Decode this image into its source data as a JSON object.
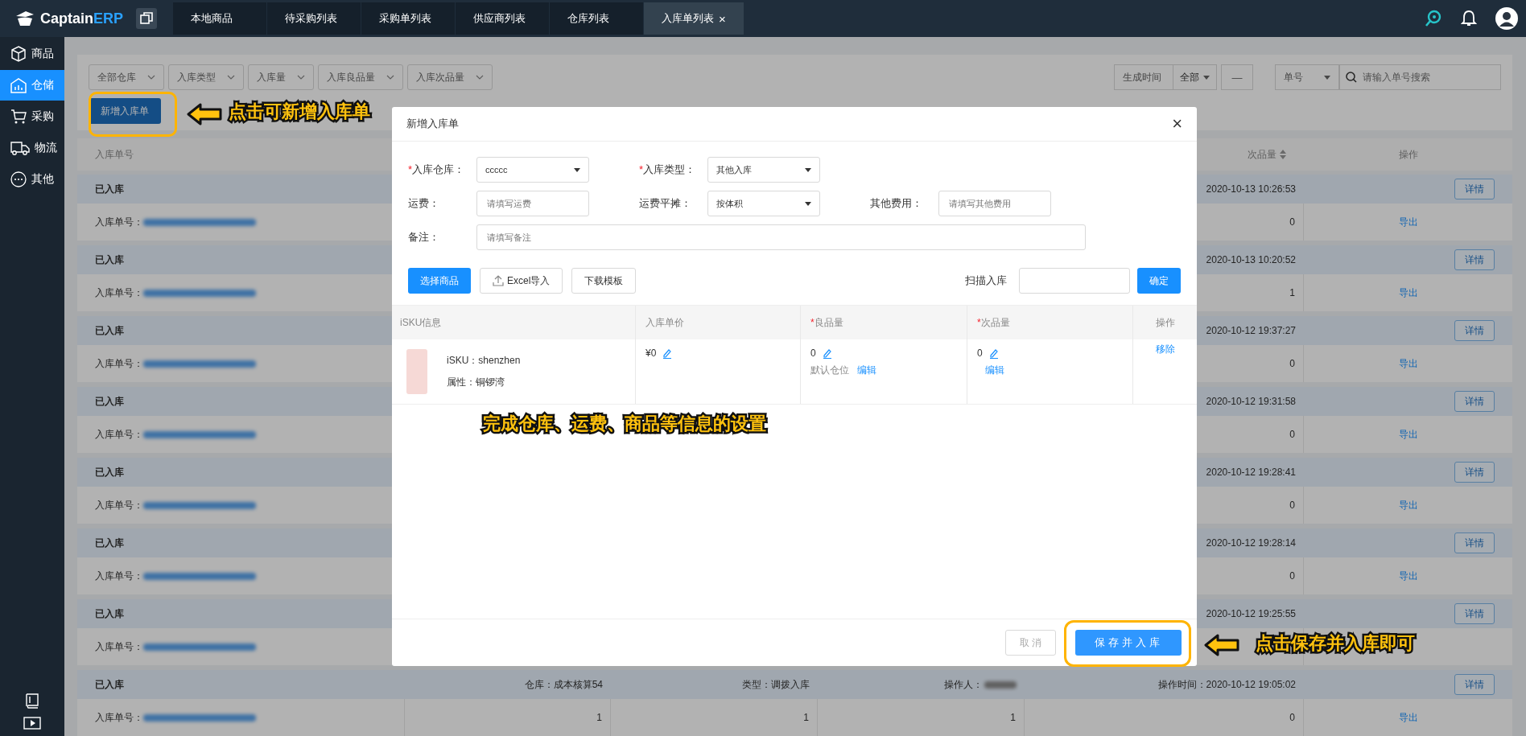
{
  "app": {
    "logo_main": "Captain",
    "logo_accent": "ERP"
  },
  "tabs": [
    {
      "label": "本地商品",
      "selected": false
    },
    {
      "label": "待采购列表",
      "selected": false
    },
    {
      "label": "采购单列表",
      "selected": false
    },
    {
      "label": "供应商列表",
      "selected": false
    },
    {
      "label": "仓库列表",
      "selected": false
    },
    {
      "label": "入库单列表",
      "selected": true,
      "close": "×"
    }
  ],
  "sidebar": {
    "items": [
      {
        "label": "商品",
        "kind": "goods",
        "selected": false
      },
      {
        "label": "仓储",
        "kind": "storage",
        "selected": true
      },
      {
        "label": "采购",
        "kind": "purchase",
        "selected": false
      },
      {
        "label": "物流",
        "kind": "logistics",
        "selected": false
      },
      {
        "label": "其他",
        "kind": "other",
        "selected": false
      }
    ]
  },
  "filters": {
    "selects": [
      "全部仓库",
      "入库类型",
      "入库量",
      "入库良品量",
      "入库次品量"
    ],
    "date_label": "生成时间",
    "date_range": "全部",
    "date_separator": "—",
    "search_by": "单号",
    "search": {
      "placeholder": "请输入单号搜索"
    }
  },
  "new_button": "新增入库单",
  "table": {
    "columns": {
      "order_no": "入库单号",
      "defect_qty": "次品量",
      "actions": "操作"
    },
    "orders": [
      {
        "status": "已入库",
        "time": "2020-10-13 10:26:53",
        "detail": "详情",
        "order_label": "入库单号：",
        "defect": "0",
        "action": "导出"
      },
      {
        "status": "已入库",
        "time": "2020-10-13 10:20:52",
        "detail": "详情",
        "order_label": "入库单号：",
        "defect": "1",
        "action": "导出"
      },
      {
        "status": "已入库",
        "time": "2020-10-12 19:37:27",
        "detail": "详情",
        "order_label": "入库单号：",
        "defect": "0",
        "action": "导出"
      },
      {
        "status": "已入库",
        "time": "2020-10-12 19:31:58",
        "detail": "详情",
        "order_label": "入库单号：",
        "defect": "0",
        "action": "导出"
      },
      {
        "status": "已入库",
        "time": "2020-10-12 19:28:41",
        "detail": "详情",
        "order_label": "入库单号：",
        "defect": "0",
        "action": "导出"
      },
      {
        "status": "已入库",
        "time": "2020-10-12 19:28:14",
        "detail": "详情",
        "order_label": "入库单号：",
        "defect": "0",
        "action": "导出"
      },
      {
        "status": "已入库",
        "time": "2020-10-12 19:25:55",
        "detail": "详情",
        "order_label": "入库单号："
      },
      {
        "status": "已入库",
        "warehouse": "仓库：成本核算54",
        "type": "类型：调拨入库",
        "operator": "操作人：",
        "time": "操作时间：2020-10-12 19:05:02",
        "detail": "详情",
        "order_label": "入库单号：",
        "cells": [
          "1",
          "1",
          "1"
        ],
        "defect": "0",
        "action": "导出"
      }
    ]
  },
  "dialog": {
    "title": "新增入库单",
    "close": "×",
    "form_rows": [
      [
        {
          "mark": "*",
          "label": "入库仓库：",
          "kind": "select",
          "value": "ccccc"
        },
        {
          "mark": "*",
          "label": "入库类型：",
          "kind": "select",
          "value": "其他入库"
        }
      ],
      [
        {
          "label": "运费：",
          "kind": "input",
          "placeholder": "请填写运费"
        },
        {
          "label": "运费平摊：",
          "kind": "select",
          "value": "按体积"
        },
        {
          "label": "其他费用：",
          "kind": "input",
          "placeholder": "请填写其他费用"
        }
      ],
      [
        {
          "label": "备注：",
          "kind": "wide",
          "placeholder": "请填写备注"
        }
      ]
    ],
    "select_goods": "选择商品",
    "excel_import": "Excel导入",
    "download_template": "下载模板",
    "scan_label": "扫描入库",
    "confirm": "确定",
    "items_columns": [
      {
        "label": "iSKU信息"
      },
      {
        "label": "入库单价"
      },
      {
        "mark": "*",
        "label": "良品量"
      },
      {
        "mark": "*",
        "label": "次品量"
      },
      {
        "label": "操作"
      }
    ],
    "items": [
      {
        "sku": "iSKU：shenzhen",
        "attr": "属性：铜锣湾",
        "price": "¥0",
        "good": "0",
        "location": "默认仓位",
        "good_edit": "编辑",
        "defect": "0",
        "defect_edit": "编辑",
        "action": "移除"
      }
    ],
    "cancel": "取 消",
    "save": "保存并入库"
  },
  "annotations": [
    "点击可新增入库单",
    "完成仓库、运费、商品等信息的设置",
    "点击保存并入库即可"
  ]
}
